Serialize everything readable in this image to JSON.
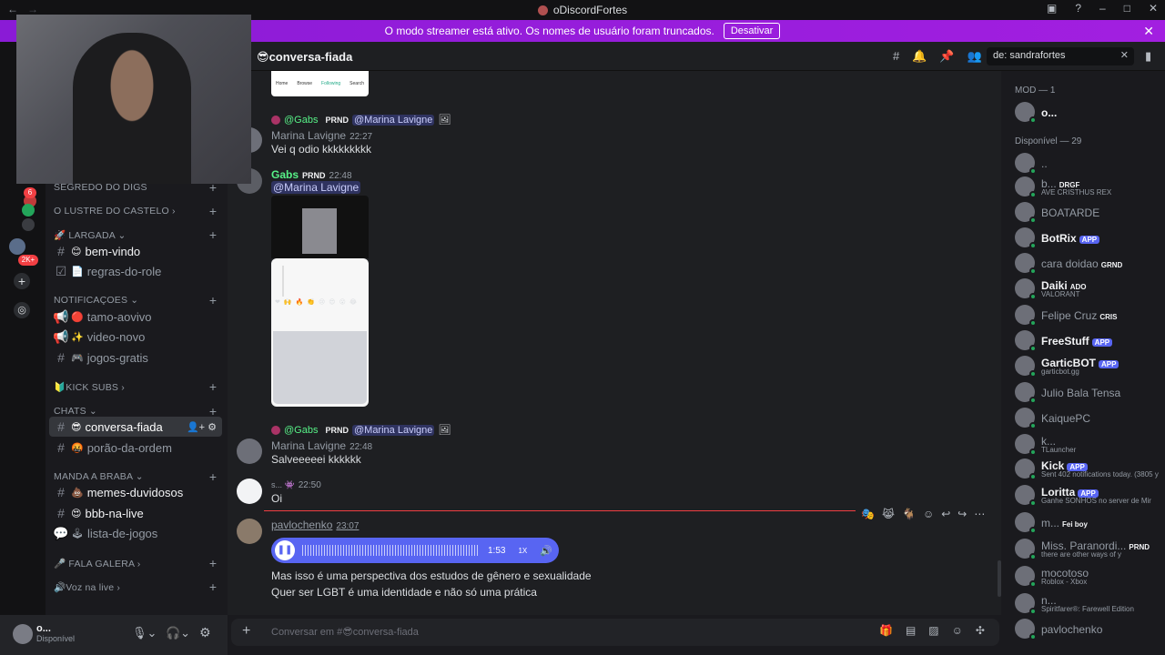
{
  "window": {
    "title": "oDiscordFortes"
  },
  "banner": {
    "text": "O modo streamer está ativo. Os nomes de usuário foram truncados.",
    "button": "Desativar"
  },
  "rail": {
    "badges": [
      "6",
      "2K+"
    ]
  },
  "sidebar": {
    "categories": [
      {
        "label": "SEGREDO DO DIGS"
      },
      {
        "label": "O LUSTRE DO CASTELO"
      },
      {
        "label": "LARGADA"
      },
      {
        "label": "NOTIFICAÇOES"
      },
      {
        "label": "KICK SUBS"
      },
      {
        "label": "CHATS"
      },
      {
        "label": "MANDA A BRABA"
      },
      {
        "label": "FALA GALERA"
      },
      {
        "label": "Voz na live"
      }
    ],
    "channels": [
      {
        "label": "bem-vindo"
      },
      {
        "label": "regras-do-role"
      },
      {
        "label": "tamo-aovivo"
      },
      {
        "label": "video-novo"
      },
      {
        "label": "jogos-gratis"
      },
      {
        "label": "conversa-fiada"
      },
      {
        "label": "porão-da-ordem"
      },
      {
        "label": "memes-duvidosos"
      },
      {
        "label": "bbb-na-live"
      },
      {
        "label": "lista-de-jogos"
      }
    ]
  },
  "user_panel": {
    "name": "o...",
    "status": "Disponível"
  },
  "header": {
    "channel": "conversa-fiada",
    "search": "de: sandrafortes"
  },
  "messages": {
    "phone_nav": [
      "Home",
      "Browse",
      "Following",
      "Search"
    ],
    "r1_author": "@Gabs",
    "r1_tag": "PRND",
    "r1_mention": "@Marina Lavigne",
    "m1_author": "Marina Lavigne",
    "m1_time": "22:27",
    "m1_text": "Vei q odio kkkkkkkkk",
    "m2_author": "Gabs",
    "m2_tag": "PRND",
    "m2_time": "22:48",
    "m2_mention": "@Marina Lavigne",
    "r2_author": "@Gabs",
    "r2_tag": "PRND",
    "r2_mention": "@Marina Lavigne",
    "m3_author": "Marina Lavigne",
    "m3_time": "22:48",
    "m3_text": "Salveeeeei kkkkkk",
    "m4_author": "s...",
    "m4_time": "22:50",
    "m4_text": "Oi",
    "m5_author": "pavlochenko",
    "m5_time": "23:07",
    "audio_time": "1:53",
    "audio_speed": "1X",
    "m5_line1": "Mas isso é uma perspectiva dos estudos de gênero e sexualidade",
    "m5_line2": "Quer ser LGBT é uma identidade e não só uma prática"
  },
  "input": {
    "placeholder": "Conversar em #",
    "channel": "conversa-fiada"
  },
  "members": {
    "mod_header": "MOD — 1",
    "online_header": "Disponível — 29",
    "list": [
      {
        "name": "o...",
        "tag": "",
        "sub": ""
      },
      {
        "name": "..",
        "tag": "",
        "sub": ""
      },
      {
        "name": "b...",
        "tag": "DRGF",
        "sub": "AVE CRISTHUS REX"
      },
      {
        "name": "BOATARDE",
        "tag": "",
        "sub": ""
      },
      {
        "name": "BotRix",
        "tag": "APP",
        "sub": ""
      },
      {
        "name": "cara doidao",
        "tag": "GRND",
        "sub": ""
      },
      {
        "name": "Daiki",
        "tag": "ADO",
        "sub": "VALORANT"
      },
      {
        "name": "Felipe Cruz",
        "tag": "CRIS",
        "sub": ""
      },
      {
        "name": "FreeStuff",
        "tag": "APP",
        "sub": ""
      },
      {
        "name": "GarticBOT",
        "tag": "APP",
        "sub": "garticbot.gg"
      },
      {
        "name": "Julio Bala Tensa",
        "tag": "",
        "sub": ""
      },
      {
        "name": "KaiquePC",
        "tag": "",
        "sub": ""
      },
      {
        "name": "k...",
        "tag": "",
        "sub": "TLauncher"
      },
      {
        "name": "Kick",
        "tag": "APP",
        "sub": "Sent 402 notifications today. (3805 y"
      },
      {
        "name": "Loritta",
        "tag": "APP",
        "sub": "Ganhe SONHOS no server de Mir"
      },
      {
        "name": "m...",
        "tag": "Fei boy",
        "sub": ""
      },
      {
        "name": "Miss. Paranordi...",
        "tag": "PRND",
        "sub": "there are other ways of y"
      },
      {
        "name": "mocotoso",
        "tag": "",
        "sub": "Roblox - Xbox"
      },
      {
        "name": "n...",
        "tag": "",
        "sub": "Spiritfarer®: Farewell Edition"
      },
      {
        "name": "pavlochenko",
        "tag": "",
        "sub": ""
      }
    ]
  }
}
